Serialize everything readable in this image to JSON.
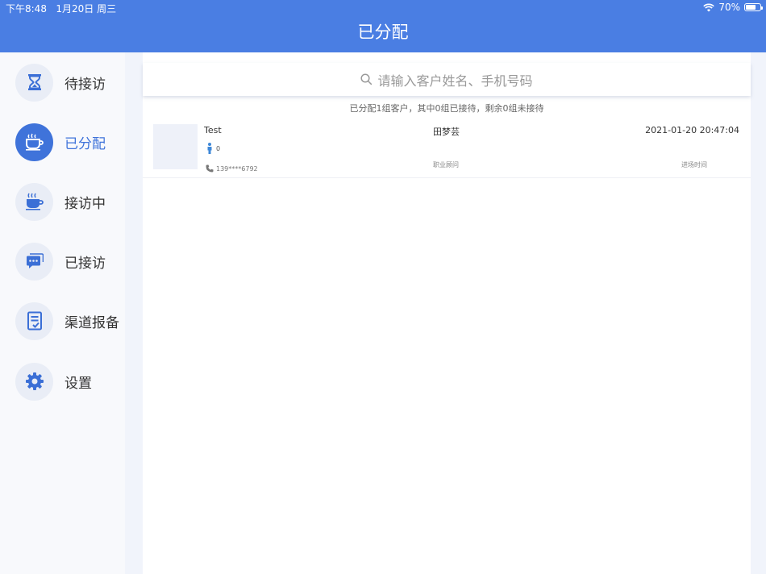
{
  "status_bar": {
    "time": "下午8:48",
    "date": "1月20日 周三",
    "battery_percent": "70%",
    "battery_level": 0.7
  },
  "header": {
    "title": "已分配"
  },
  "sidebar": {
    "items": [
      {
        "label": "待接访",
        "icon": "hourglass-icon",
        "active": false
      },
      {
        "label": "已分配",
        "icon": "coffee-cup-icon",
        "active": true
      },
      {
        "label": "接访中",
        "icon": "steaming-cup-icon",
        "active": false
      },
      {
        "label": "已接访",
        "icon": "chat-bubble-icon",
        "active": false
      },
      {
        "label": "渠道报备",
        "icon": "document-check-icon",
        "active": false
      },
      {
        "label": "设置",
        "icon": "gear-icon",
        "active": false
      }
    ]
  },
  "search": {
    "placeholder": "请输入客户姓名、手机号码"
  },
  "summary": "已分配1组客户，其中0组已接待，剩余0组未接待",
  "customers": [
    {
      "name": "Test",
      "visitor_count": "0",
      "phone": "139****6792",
      "consultant": "田梦芸",
      "consultant_label": "职业顾问",
      "arrival_time": "2021-01-20 20:47:04",
      "arrival_label": "进场时间"
    }
  ],
  "colors": {
    "primary": "#4a7ee3",
    "active": "#3f73da"
  }
}
